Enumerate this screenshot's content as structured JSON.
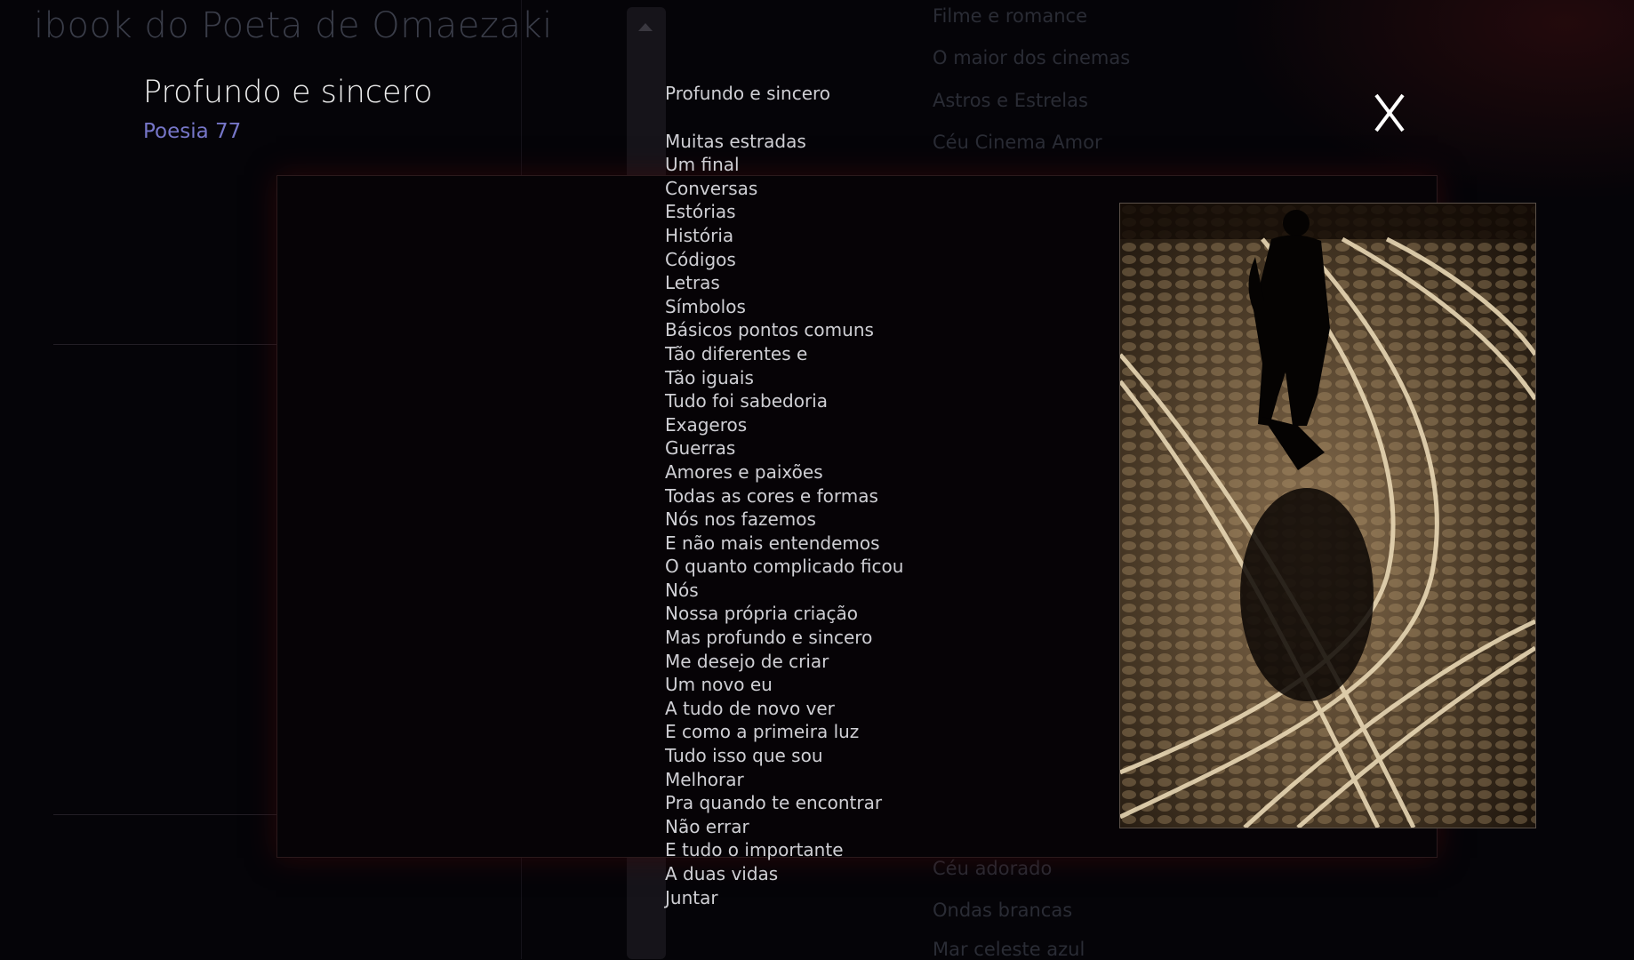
{
  "app": {
    "title": "ibook do Poeta de Omaezaki"
  },
  "background_menu": {
    "top_items": [
      "Filme e romance",
      "O maior dos cinemas",
      "Astros e Estrelas",
      "Céu Cinema Amor"
    ],
    "bottom_items": [
      "Céu adorado",
      "Ondas brancas",
      "Mar celeste azul"
    ]
  },
  "poem": {
    "title": "Profundo e sincero",
    "subtitle": "Poesia 77",
    "heading": "Profundo e sincero",
    "lines": [
      "Muitas estradas",
      "Um final",
      "Conversas",
      "Estórias",
      "História",
      "Códigos",
      "Letras",
      "Símbolos",
      "Básicos pontos comuns",
      "Tão diferentes e",
      "Tão iguais",
      "Tudo foi sabedoria",
      "Exageros",
      "Guerras",
      "Amores e paixões",
      "Todas as cores e formas",
      "Nós nos fazemos",
      "E não mais entendemos",
      "O quanto complicado ficou",
      "Nós",
      "Nossa própria criação",
      "Mas profundo e sincero",
      "Me desejo de criar",
      "Um novo eu",
      "A tudo de novo ver",
      "E como a primeira luz",
      "Tudo isso que sou",
      "Melhorar",
      "Pra quando te encontrar",
      "Não errar",
      "E tudo o importante",
      "A duas vidas",
      "Juntar"
    ]
  },
  "modal": {
    "close_label": "X",
    "close_icon": "close-icon",
    "image_icon": "photo-silhouette-tram-tracks"
  },
  "colors": {
    "background": "#050408",
    "accent_subtitle": "#7676c8",
    "text": "#cfcfd4"
  }
}
